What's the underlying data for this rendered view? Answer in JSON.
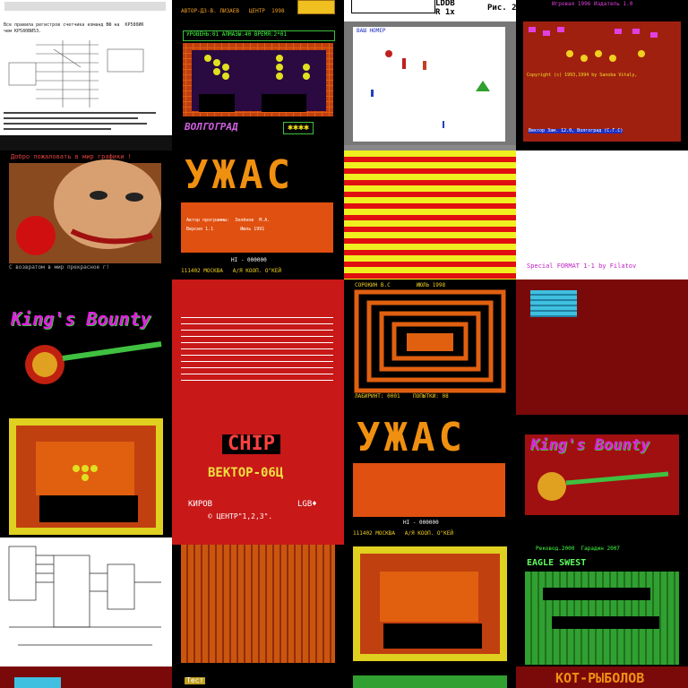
{
  "tiles": {
    "r0c0": {
      "lines": [
        "Все правила регистров счетчика команд ВФ на  КР580ИК",
        "чем КР580ВИ53."
      ]
    },
    "r0c1": {
      "caption": "АВТОР-ДЗ-В. ЛИЗАЕВ   ЦЕНТР  1998"
    },
    "r0c2": {
      "code1": "LDDB",
      "code2": "R 1x",
      "fig": "Рис. 2"
    },
    "r0c3": {
      "caption": "Игровая 1996 Издатель 1.0"
    },
    "r1c1": {
      "status": "УРОВЕНЬ:01 АЛМАЗЫ:40 ВРЕМЯ:2*01",
      "city": "ВОЛГОГРАД",
      "stars": "✱✱✱✱"
    },
    "r1c2": {
      "label": "ВАШ НОМЕР"
    },
    "r1c3": {
      "credits1": "Copyright (c) 1993,1994 by Sanoba Vitaly,",
      "credits2": "Вектор Зам. 12.0, Волгоград (С.Г.С)"
    },
    "r2c0": {
      "top": "Добро пожаловать в мир графики !",
      "bottom": "С возвратом в мир прекрасное г!"
    },
    "r2c1": {
      "title": "УЖАС",
      "line1": "Автор программы:  Зелёнов  М.А.",
      "line2": "Версия 1.1          Июль 1991",
      "hi": "HI - 000000",
      "addr": "111402 МОСКВА   А/Я КООП. О\"КЕЙ"
    },
    "r2c3": {
      "footer": "Special FORMAT 1-1 by Filatov"
    },
    "r3c0": {
      "title": "King's Bounty"
    },
    "r3c2": {
      "top": "СОРОКИН В.С        ИЮЛЬ 1998",
      "bottom": "ЛАБИРИНТ: 0001    ПОПЫТКИ: 08"
    },
    "r4c1": {
      "chip": "CHIP",
      "vector": "ВЕКТОР-06Ц",
      "city": "КИРОВ",
      "lgb": "LGB♦",
      "center": "© ЦЕНТР\"1,2,3\"."
    },
    "r4c2": {
      "title": "УЖАС",
      "hi": "HI - 000000",
      "addr": "111402 МОСКВА   А/Я КООП. О\"КЕЙ"
    },
    "r4c3": {
      "title": "King's Bounty"
    },
    "r5c3": {
      "top": "Рековод.2000  Гарадин 2007",
      "title": "EAGLE SWEST"
    },
    "r6c1": {
      "label": "Тест"
    },
    "r6c3": {
      "title": "КОТ-РЫБОЛОВ"
    }
  },
  "colors": {
    "bg": "#000000",
    "red": "#c81010",
    "orange": "#e05010",
    "yellow": "#f0e020",
    "white": "#ffffff",
    "magenta": "#c020c0",
    "green": "#30a030"
  }
}
